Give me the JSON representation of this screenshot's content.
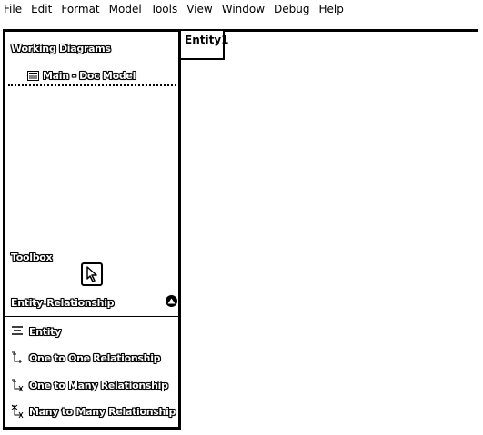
{
  "menu": [
    "File",
    "Edit",
    "Format",
    "Model",
    "Tools",
    "View",
    "Window",
    "Debug",
    "Help"
  ],
  "left_panel": {
    "title": "Working Diagrams",
    "diagram_item": "Main - Doc Model",
    "toolbox_title": "Toolbox",
    "section_title": "Entity-Relationship",
    "tools": [
      {
        "label": "Entity",
        "icon": "entity-icon"
      },
      {
        "label": "One to One Relationship",
        "icon": "one-to-one-icon"
      },
      {
        "label": "One to Many Relationship",
        "icon": "one-to-many-icon"
      },
      {
        "label": "Many to Many Relationship",
        "icon": "many-to-many-icon"
      }
    ]
  },
  "canvas": {
    "tab_label": "Entity1"
  }
}
